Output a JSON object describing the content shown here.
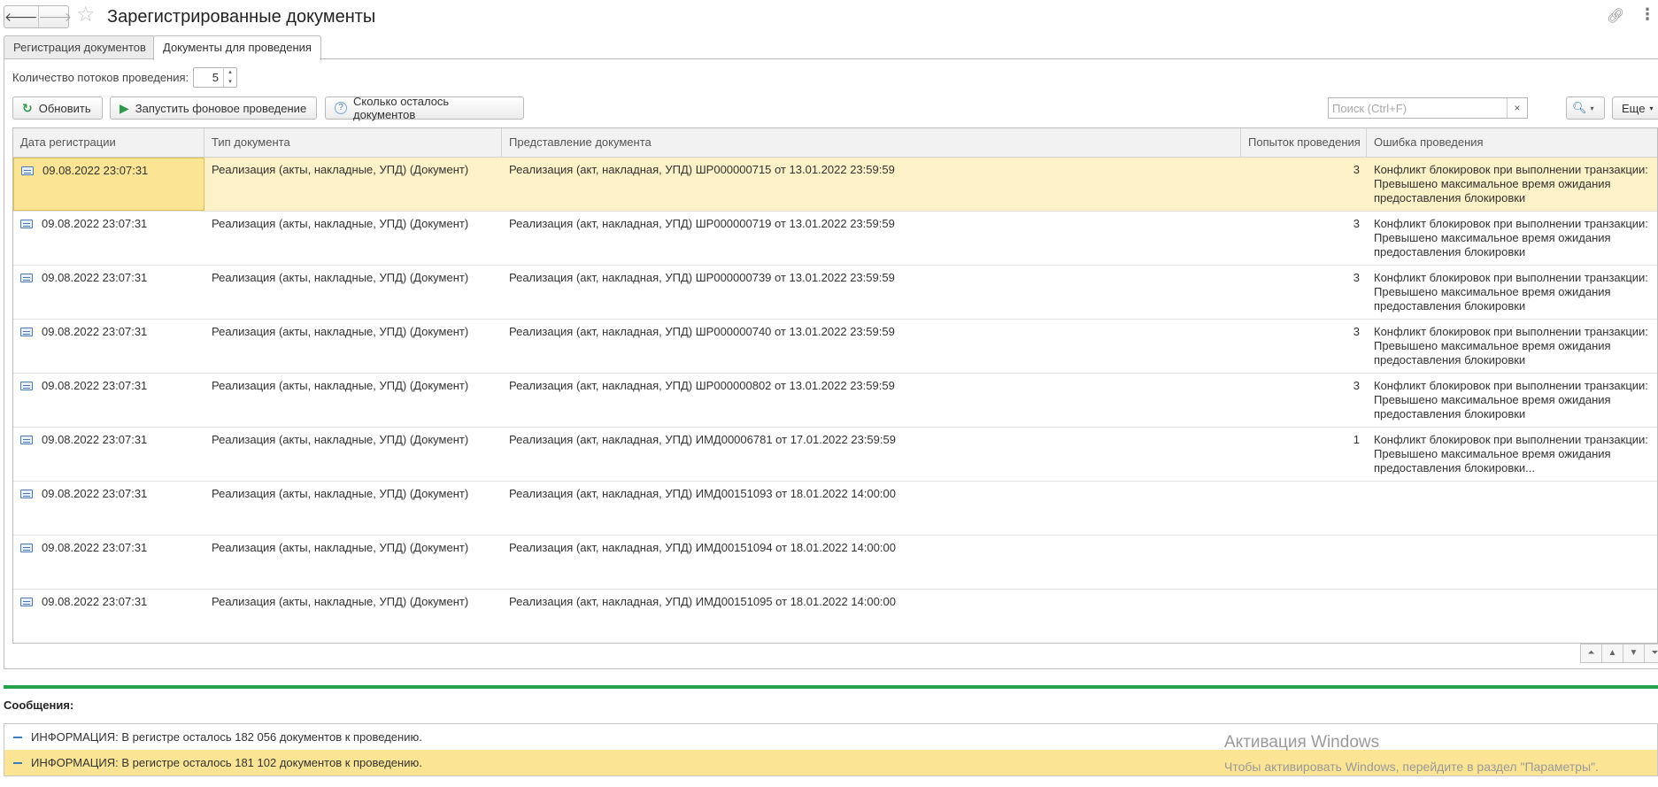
{
  "header": {
    "back_glyph": "🡐",
    "forward_glyph": "🡒",
    "title": "Зарегистрированные документы",
    "star_icon": "star-icon",
    "link_icon": "link-icon",
    "more_icon": "more-vertical-icon"
  },
  "tabs": [
    {
      "label": "Регистрация документов",
      "active": false
    },
    {
      "label": "Документы для проведения",
      "active": true
    }
  ],
  "threads": {
    "label": "Количество потоков проведения:",
    "value": "5"
  },
  "toolbar": {
    "refresh_label": "Обновить",
    "start_label": "Запустить фоновое проведение",
    "remaining_label": "Сколько осталось документов",
    "search_placeholder": "Поиск (Ctrl+F)",
    "clear_glyph": "×",
    "search_glyph": "🔍︎",
    "more_label": "Еще"
  },
  "table": {
    "columns": [
      "Дата регистрации",
      "Тип документа",
      "Представление документа",
      "Попыток проведения",
      "Ошибка проведения"
    ],
    "rows": [
      {
        "date": "09.08.2022 23:07:31",
        "type": "Реализация (акты, накладные, УПД) (Документ)",
        "doc": "Реализация (акт, накладная, УПД) ШР000000715 от 13.01.2022 23:59:59",
        "attempts": "3",
        "error": "Конфликт блокировок при выполнении транзакции:\nПревышено максимальное время ожидания\nпредоставления блокировки"
      },
      {
        "date": "09.08.2022 23:07:31",
        "type": "Реализация (акты, накладные, УПД) (Документ)",
        "doc": "Реализация (акт, накладная, УПД) ШР000000719 от 13.01.2022 23:59:59",
        "attempts": "3",
        "error": "Конфликт блокировок при выполнении транзакции:\nПревышено максимальное время ожидания\nпредоставления блокировки"
      },
      {
        "date": "09.08.2022 23:07:31",
        "type": "Реализация (акты, накладные, УПД) (Документ)",
        "doc": "Реализация (акт, накладная, УПД) ШР000000739 от 13.01.2022 23:59:59",
        "attempts": "3",
        "error": "Конфликт блокировок при выполнении транзакции:\nПревышено максимальное время ожидания\nпредоставления блокировки"
      },
      {
        "date": "09.08.2022 23:07:31",
        "type": "Реализация (акты, накладные, УПД) (Документ)",
        "doc": "Реализация (акт, накладная, УПД) ШР000000740 от 13.01.2022 23:59:59",
        "attempts": "3",
        "error": "Конфликт блокировок при выполнении транзакции:\nПревышено максимальное время ожидания\nпредоставления блокировки"
      },
      {
        "date": "09.08.2022 23:07:31",
        "type": "Реализация (акты, накладные, УПД) (Документ)",
        "doc": "Реализация (акт, накладная, УПД) ШР000000802 от 13.01.2022 23:59:59",
        "attempts": "3",
        "error": "Конфликт блокировок при выполнении транзакции:\nПревышено максимальное время ожидания\nпредоставления блокировки"
      },
      {
        "date": "09.08.2022 23:07:31",
        "type": "Реализация (акты, накладные, УПД) (Документ)",
        "doc": "Реализация (акт, накладная, УПД) ИМД00006781 от 17.01.2022 23:59:59",
        "attempts": "1",
        "error": "Конфликт блокировок при выполнении транзакции:\nПревышено максимальное время ожидания\nпредоставления блокировки..."
      },
      {
        "date": "09.08.2022 23:07:31",
        "type": "Реализация (акты, накладные, УПД) (Документ)",
        "doc": "Реализация (акт, накладная, УПД) ИМД00151093 от 18.01.2022 14:00:00",
        "attempts": "",
        "error": ""
      },
      {
        "date": "09.08.2022 23:07:31",
        "type": "Реализация (акты, накладные, УПД) (Документ)",
        "doc": "Реализация (акт, накладная, УПД) ИМД00151094 от 18.01.2022 14:00:00",
        "attempts": "",
        "error": ""
      },
      {
        "date": "09.08.2022 23:07:31",
        "type": "Реализация (акты, накладные, УПД) (Документ)",
        "doc": "Реализация (акт, накладная, УПД) ИМД00151095 от 18.01.2022 14:00:00",
        "attempts": "",
        "error": ""
      }
    ],
    "selected_row": 0,
    "scroll_glyphs": [
      "⏶",
      "▲",
      "▼",
      "⏷"
    ]
  },
  "messages": {
    "title": "Сообщения:",
    "items": [
      {
        "text": "ИНФОРМАЦИЯ: В регистре осталось 182 056 документов к проведению.",
        "selected": false
      },
      {
        "text": "ИНФОРМАЦИЯ: В регистре осталось 181 102 документов к проведению.",
        "selected": true
      }
    ]
  },
  "watermark": {
    "line1": "Активация Windows",
    "line2": "Чтобы активировать Windows, перейдите в раздел \"Параметры\"."
  },
  "colors": {
    "accent_green": "#27a04b",
    "selection": "#fbe493",
    "selection_row": "#fcf1c7"
  }
}
